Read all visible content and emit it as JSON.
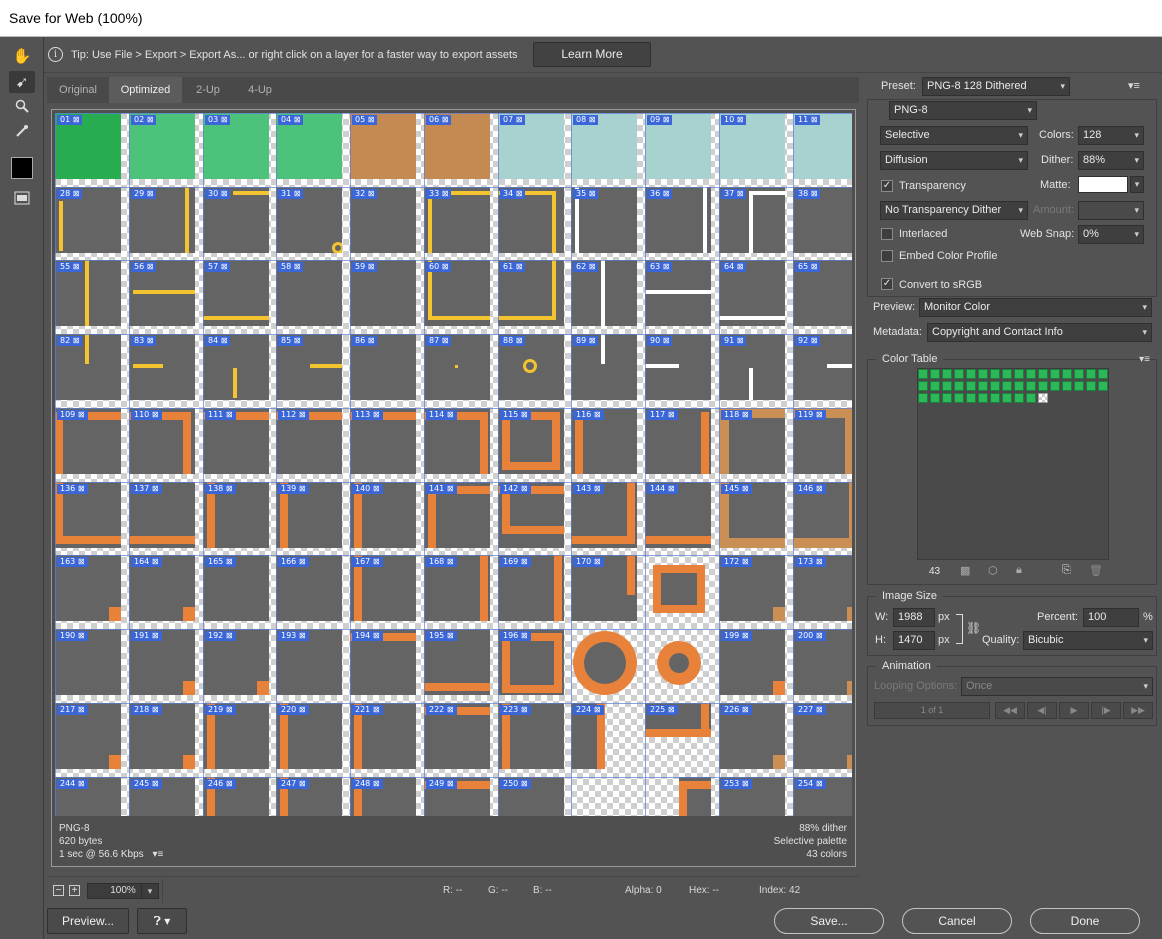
{
  "window": {
    "title": "Save for Web (100%)"
  },
  "tools": [
    {
      "name": "hand-tool",
      "glyph": "✋"
    },
    {
      "name": "slice-select-tool",
      "glyph": "➹"
    },
    {
      "name": "zoom-tool",
      "glyph": "🔍"
    },
    {
      "name": "eyedropper-tool",
      "glyph": "✎"
    }
  ],
  "tip": {
    "text": "Tip: Use File > Export > Export As...  or right click on a layer for a faster way to export assets",
    "button": "Learn More"
  },
  "tabs": [
    "Original",
    "Optimized",
    "2-Up",
    "4-Up"
  ],
  "slice_numbers": [
    [
      "01",
      "02",
      "03",
      "04",
      "05",
      "06",
      "07",
      "08",
      "09",
      "10",
      "11"
    ],
    [
      "28",
      "29",
      "30",
      "31",
      "32",
      "33",
      "34",
      "35",
      "36",
      "37",
      "38"
    ],
    [
      "55",
      "56",
      "57",
      "58",
      "59",
      "60",
      "61",
      "62",
      "63",
      "64",
      "65"
    ],
    [
      "82",
      "83",
      "84",
      "85",
      "86",
      "87",
      "88",
      "89",
      "90",
      "91",
      "92"
    ],
    [
      "109",
      "110",
      "111",
      "112",
      "113",
      "114",
      "115",
      "116",
      "117",
      "118",
      "119"
    ],
    [
      "136",
      "137",
      "138",
      "139",
      "140",
      "141",
      "142",
      "143",
      "144",
      "145",
      "146"
    ],
    [
      "163",
      "164",
      "165",
      "166",
      "167",
      "168",
      "169",
      "170",
      "",
      "172",
      "173"
    ],
    [
      "190",
      "191",
      "192",
      "193",
      "194",
      "195",
      "196",
      "",
      "",
      "199",
      "200"
    ],
    [
      "217",
      "218",
      "219",
      "220",
      "221",
      "222",
      "223",
      "224",
      "225",
      "226",
      "227"
    ],
    [
      "244",
      "245",
      "246",
      "247",
      "248",
      "249",
      "250",
      "",
      "",
      "253",
      "254"
    ]
  ],
  "preview_info": {
    "format": "PNG-8",
    "size": "620 bytes",
    "time": "1 sec @ 56.6 Kbps",
    "dither": "88% dither",
    "palette": "Selective palette",
    "colors": "43 colors"
  },
  "status": {
    "zoom": "100%",
    "r": "R: --",
    "g": "G: --",
    "b": "B: --",
    "alpha": "Alpha: 0",
    "hex": "Hex: --",
    "index": "Index: 42"
  },
  "settings": {
    "preset_label": "Preset:",
    "preset": "PNG-8 128 Dithered",
    "format": "PNG-8",
    "reduction": "Selective",
    "colors_label": "Colors:",
    "colors": "128",
    "dither_algo": "Diffusion",
    "dither_label": "Dither:",
    "dither": "88%",
    "transparency": "Transparency",
    "transparency_checked": true,
    "matte_label": "Matte:",
    "transparency_dither": "No Transparency Dither",
    "amount_label": "Amount:",
    "interlaced": "Interlaced",
    "interlaced_checked": false,
    "websnap_label": "Web Snap:",
    "websnap": "0%",
    "embed_profile": "Embed Color Profile",
    "embed_checked": false,
    "convert_srgb": "Convert to sRGB",
    "convert_checked": true,
    "preview_label": "Preview:",
    "preview": "Monitor Color",
    "metadata_label": "Metadata:",
    "metadata": "Copyright and Contact Info"
  },
  "color_table": {
    "title": "Color Table",
    "count": "43",
    "color": "#2cb859"
  },
  "image_size": {
    "title": "Image Size",
    "w_label": "W:",
    "width": "1988",
    "unit": "px",
    "h_label": "H:",
    "height": "1470",
    "percent_label": "Percent:",
    "percent": "100",
    "percent_unit": "%",
    "quality_label": "Quality:",
    "quality": "Bicubic"
  },
  "animation": {
    "title": "Animation",
    "looping_label": "Looping Options:",
    "looping": "Once",
    "frame": "1 of 1"
  },
  "footer": {
    "preview": "Preview...",
    "save": "Save...",
    "cancel": "Cancel",
    "done": "Done"
  },
  "colors": {
    "ui_bg": "#535353",
    "tile_gray": "#646464",
    "yellow": "#f4c430",
    "orange": "#e8823a",
    "tan": "#c98f55",
    "green": "#2cb859",
    "slice_blue": "#3b66d8"
  }
}
